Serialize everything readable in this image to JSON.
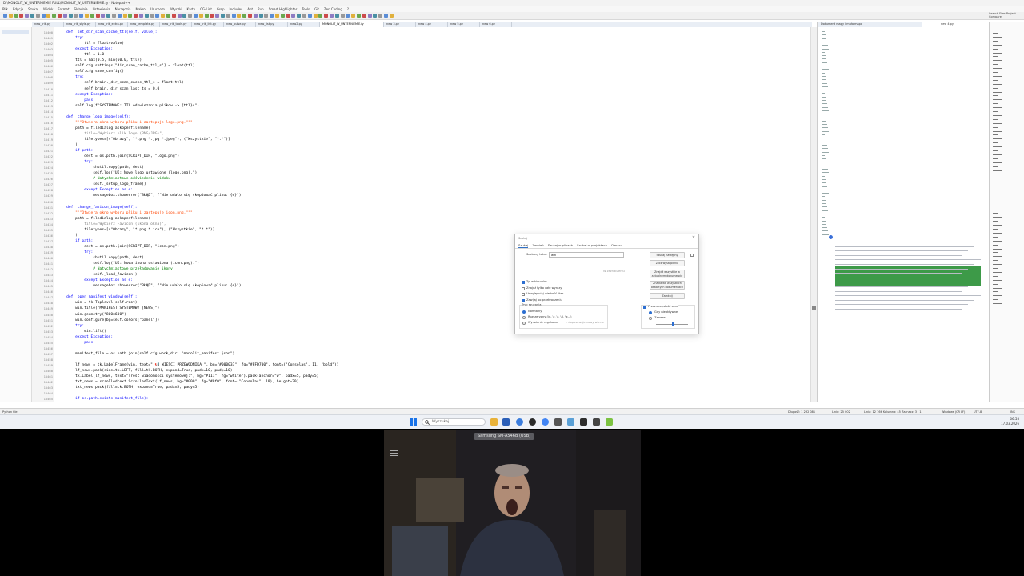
{
  "window": {
    "title": "D:\\MONOLIT_W_UNTERNIEMIE FULL\\MONOLIT_W_UNTERNIEMIE.fy - Notepad++"
  },
  "menu": [
    "Plik",
    "Edycja",
    "Szukaj",
    "Widok",
    "Format",
    "Składnia",
    "Ustawienia",
    "Narzędzia",
    "Makro",
    "Uruchom",
    "Wtyczki",
    "Karty",
    "CG-Lint",
    "Grep",
    "Includes",
    "Ant",
    "Run",
    "Smart Highlighter",
    "Tools",
    "Git",
    "Zen Coding",
    "?"
  ],
  "right_header": {
    "line1": "Search Files Project",
    "line2": "Compare"
  },
  "tabs": [
    "new_trik.py",
    "new_trik_style.py",
    "new_trik_extra.py",
    "new_template.py",
    "new_trik_tools.py",
    "new_trik_list.py",
    "new_pulse.py",
    "new_list.py",
    "new2.py",
    "MONOLIT_W_UNTERNIEMIE.fy",
    "new 3.py",
    "new 4.py",
    "new 5.py",
    "new 6.py"
  ],
  "active_tab": "MONOLIT_W_UNTERNIEMIE.fy",
  "docmap_tabs": [
    "Dokument mapy i mała mapa",
    "new 4.py"
  ],
  "code_lines": [
    {
      "n": "15400",
      "t": "    def  set_dir_scan_cache_ttl(self, value):",
      "c": "#0000ff"
    },
    {
      "n": "15401",
      "t": "        try:",
      "c": "#0000ff"
    },
    {
      "n": "15402",
      "t": "            ttl = float(value)",
      "c": "#000000"
    },
    {
      "n": "15403",
      "t": "        except Exception:",
      "c": "#0000ff"
    },
    {
      "n": "15404",
      "t": "            ttl = 1.0",
      "c": "#000000"
    },
    {
      "n": "15405",
      "t": "        ttl = max(0.5, min(60.0, ttl))",
      "c": "#000000"
    },
    {
      "n": "15406",
      "t": "        self.cfg.settings[\"dir_scan_cache_ttl_s\"] = float(ttl)",
      "c": "#000000"
    },
    {
      "n": "15407",
      "t": "        self.cfg.save_config()",
      "c": "#000000"
    },
    {
      "n": "15408",
      "t": "        try:",
      "c": "#0000ff"
    },
    {
      "n": "15409",
      "t": "            self.brain._dir_scan_cache_ttl_s = float(ttl)",
      "c": "#000000"
    },
    {
      "n": "15410",
      "t": "            self.brain._dir_scan_last_ts = 0.0",
      "c": "#000000"
    },
    {
      "n": "15411",
      "t": "        except Exception:",
      "c": "#0000ff"
    },
    {
      "n": "15412",
      "t": "            pass",
      "c": "#0000ff"
    },
    {
      "n": "15413",
      "t": "        self.log(f\"SYSTEMOWE: TTL odswiezania plikow -> {ttl}s\")",
      "c": "#000000"
    },
    {
      "n": "15414",
      "t": "",
      "c": "#000000"
    },
    {
      "n": "15415",
      "t": "    def  change_logo_image(self):",
      "c": "#0000ff"
    },
    {
      "n": "15416",
      "t": "        \"\"\"Otwiera okno wyboru pliku i zastępuje logo.png.\"\"\"",
      "c": "#ff4400"
    },
    {
      "n": "15417",
      "t": "        path = filedialog.askopenfilename(",
      "c": "#000000"
    },
    {
      "n": "15418",
      "t": "            title=\"Wybierz plik logo (PNG/JPG)\",",
      "c": "#808080"
    },
    {
      "n": "15419",
      "t": "            filetypes=[(\"Obrazy\", \"*.png *.jpg *.jpeg\"), (\"Wszystkie\", \"*.*\")]",
      "c": "#000000"
    },
    {
      "n": "15420",
      "t": "        )",
      "c": "#000000"
    },
    {
      "n": "15421",
      "t": "        if path:",
      "c": "#0000ff"
    },
    {
      "n": "15422",
      "t": "            dest = os.path.join(SCRIPT_DIR, \"logo.png\")",
      "c": "#000000"
    },
    {
      "n": "15423",
      "t": "            try:",
      "c": "#0000ff"
    },
    {
      "n": "15424",
      "t": "                shutil.copy(path, dest)",
      "c": "#000000"
    },
    {
      "n": "15425",
      "t": "                self.log(\"UI: Nowe logo ustawione (logo.png).\")",
      "c": "#000000"
    },
    {
      "n": "15426",
      "t": "                # Natychmiastowe odświeżenie widoku",
      "c": "#008000"
    },
    {
      "n": "15427",
      "t": "                self._setup_logo_frame()",
      "c": "#000000"
    },
    {
      "n": "15428",
      "t": "            except Exception as e:",
      "c": "#0000ff"
    },
    {
      "n": "15429",
      "t": "                messagebox.showerror(\"BŁĄD\", f\"Nie udało się skopiować pliku: {e}\")",
      "c": "#000000"
    },
    {
      "n": "15430",
      "t": "",
      "c": "#000000"
    },
    {
      "n": "15431",
      "t": "    def  change_favicon_image(self):",
      "c": "#0000ff"
    },
    {
      "n": "15432",
      "t": "        \"\"\"Otwiera okno wyboru pliku i zastępuje icon.png.\"\"\"",
      "c": "#ff4400"
    },
    {
      "n": "15433",
      "t": "        path = filedialog.askopenfilename(",
      "c": "#000000"
    },
    {
      "n": "15434",
      "t": "            title=\"Wybierz Favicon (ikona okna)\",",
      "c": "#808080"
    },
    {
      "n": "15435",
      "t": "            filetypes=[(\"Obrazy\", \"*.png *.ico\"), (\"Wszystkie\", \"*.*\")]",
      "c": "#000000"
    },
    {
      "n": "15436",
      "t": "        )",
      "c": "#000000"
    },
    {
      "n": "15437",
      "t": "        if path:",
      "c": "#0000ff"
    },
    {
      "n": "15438",
      "t": "            dest = os.path.join(SCRIPT_DIR, \"icon.png\")",
      "c": "#000000"
    },
    {
      "n": "15439",
      "t": "            try:",
      "c": "#0000ff"
    },
    {
      "n": "15440",
      "t": "                shutil.copy(path, dest)",
      "c": "#000000"
    },
    {
      "n": "15441",
      "t": "                self.log(\"UI: Nowa ikona ustawiona (icon.png).\")",
      "c": "#000000"
    },
    {
      "n": "15442",
      "t": "                # Natychmiastowe przeładowanie ikony",
      "c": "#008000"
    },
    {
      "n": "15443",
      "t": "                self._load_favicon()",
      "c": "#000000"
    },
    {
      "n": "15444",
      "t": "            except Exception as e:",
      "c": "#0000ff"
    },
    {
      "n": "15445",
      "t": "                messagebox.showerror(\"BŁĄD\", f\"Nie udało się skopiować pliku: {e}\")",
      "c": "#000000"
    },
    {
      "n": "15446",
      "t": "",
      "c": "#000000"
    },
    {
      "n": "15447",
      "t": "    def  open_manifest_window(self):",
      "c": "#0000ff"
    },
    {
      "n": "15448",
      "t": "        win = tk.Toplevel(self.root)",
      "c": "#000000"
    },
    {
      "n": "15449",
      "t": "        win.title(\"MANIFEST SYSTEMOWY [NEWS]\")",
      "c": "#000000"
    },
    {
      "n": "15450",
      "t": "        win.geometry(\"800x600\")",
      "c": "#000000"
    },
    {
      "n": "15451",
      "t": "        win.configure(bg=self.colors[\"panel\"])",
      "c": "#000000"
    },
    {
      "n": "15452",
      "t": "        try:",
      "c": "#0000ff"
    },
    {
      "n": "15453",
      "t": "            win.lift()",
      "c": "#000000"
    },
    {
      "n": "15454",
      "t": "        except Exception:",
      "c": "#0000ff"
    },
    {
      "n": "15455",
      "t": "            pass",
      "c": "#0000ff"
    },
    {
      "n": "15456",
      "t": "",
      "c": "#000000"
    },
    {
      "n": "15457",
      "t": "        manifest_file = os.path.join(self.cfg.work_dir, \"monolit_manifest.json\")",
      "c": "#000000"
    },
    {
      "n": "15458",
      "t": "",
      "c": "#000000"
    },
    {
      "n": "15459",
      "t": "        lf_news = tk.LabelFrame(win, text=\" 📢 WIEŚCI PRZEWODNIKA \", bg=\"#000033\", fg=\"#FFD700\", font=(\"Consolas\", 11, \"bold\"))",
      "c": "#000000"
    },
    {
      "n": "15460",
      "t": "        lf_news.pack(side=tk.LEFT, fill=tk.BOTH, expand=True, padx=10, pady=10)",
      "c": "#000000"
    },
    {
      "n": "15461",
      "t": "        tk.Label(lf_news, text=\"Treść wiadomości systemowej:\", bg=\"#111\", fg=\"white\").pack(anchor=\"w\", padx=5, pady=5)",
      "c": "#000000"
    },
    {
      "n": "15462",
      "t": "        txt_news = scrolledtext.ScrolledText(lf_news, bg=\"#000\", fg=\"#0f0\", font=(\"Consolas\", 10), height=20)",
      "c": "#000000"
    },
    {
      "n": "15463",
      "t": "        txt_news.pack(fill=tk.BOTH, expand=True, padx=5, pady=5)",
      "c": "#000000"
    },
    {
      "n": "15464",
      "t": "",
      "c": "#000000"
    },
    {
      "n": "15465",
      "t": "        if os.path.exists(manifest_file):",
      "c": "#0000ff"
    }
  ],
  "dialog": {
    "title": "Szukaj",
    "tabs": [
      "Szukaj",
      "Zamień",
      "Szukaj w plikach",
      "Szukaj w projektach",
      "Oznacz"
    ],
    "find_label": "Szukany tekst:",
    "find_value": "win",
    "in_selection": "W zaznaczeniu",
    "buttons": [
      "Szukaj następny",
      "Zlicz wystąpienia",
      "Znajdź wszystkie w aktualnym dokumencie",
      "Znajdź we wszystkich otwartych dokumentach",
      "Zamknij"
    ],
    "options": [
      "Tył w kierunku",
      "Znajdź tylko całe wyrazy",
      "Uwzględniaj wielkość liter",
      "Zawijaj po przekroczeniu"
    ],
    "options_on": [
      true,
      false,
      false,
      true
    ],
    "mode_label": "Tryb szukania",
    "modes": [
      "Normalny",
      "Rozszerzony (\\n, \\r, \\t, \\0, \\x...)",
      "Wyrażenie regularne"
    ],
    "dot_newline": ". dopasowuje nowy wiersz",
    "transparency_label": "Przezroczystość okna",
    "transparency_modes": [
      "Gdy nieaktywne",
      "Zawsze"
    ]
  },
  "statusbar": {
    "language": "Python file",
    "length": "Długość: 1 232 081",
    "lines": "Linie: 25 002",
    "position": "Linia: 12 766    Kolumna: 45    Zaznacz: 3 | 1",
    "eol": "Windows (CR LF)",
    "encoding": "UTF-8",
    "mode": "INS"
  },
  "taskbar": {
    "search_placeholder": "Wyszukaj",
    "time": "06:58",
    "date": "17.03.2026"
  },
  "webcam": {
    "label": "Samsung SM-A546B (USB)"
  },
  "colors": {
    "keyword": "#0000ff",
    "string": "#808080",
    "docstring": "#ff4400",
    "comment": "#008000",
    "docmap_highlight": "#3d9a48"
  }
}
